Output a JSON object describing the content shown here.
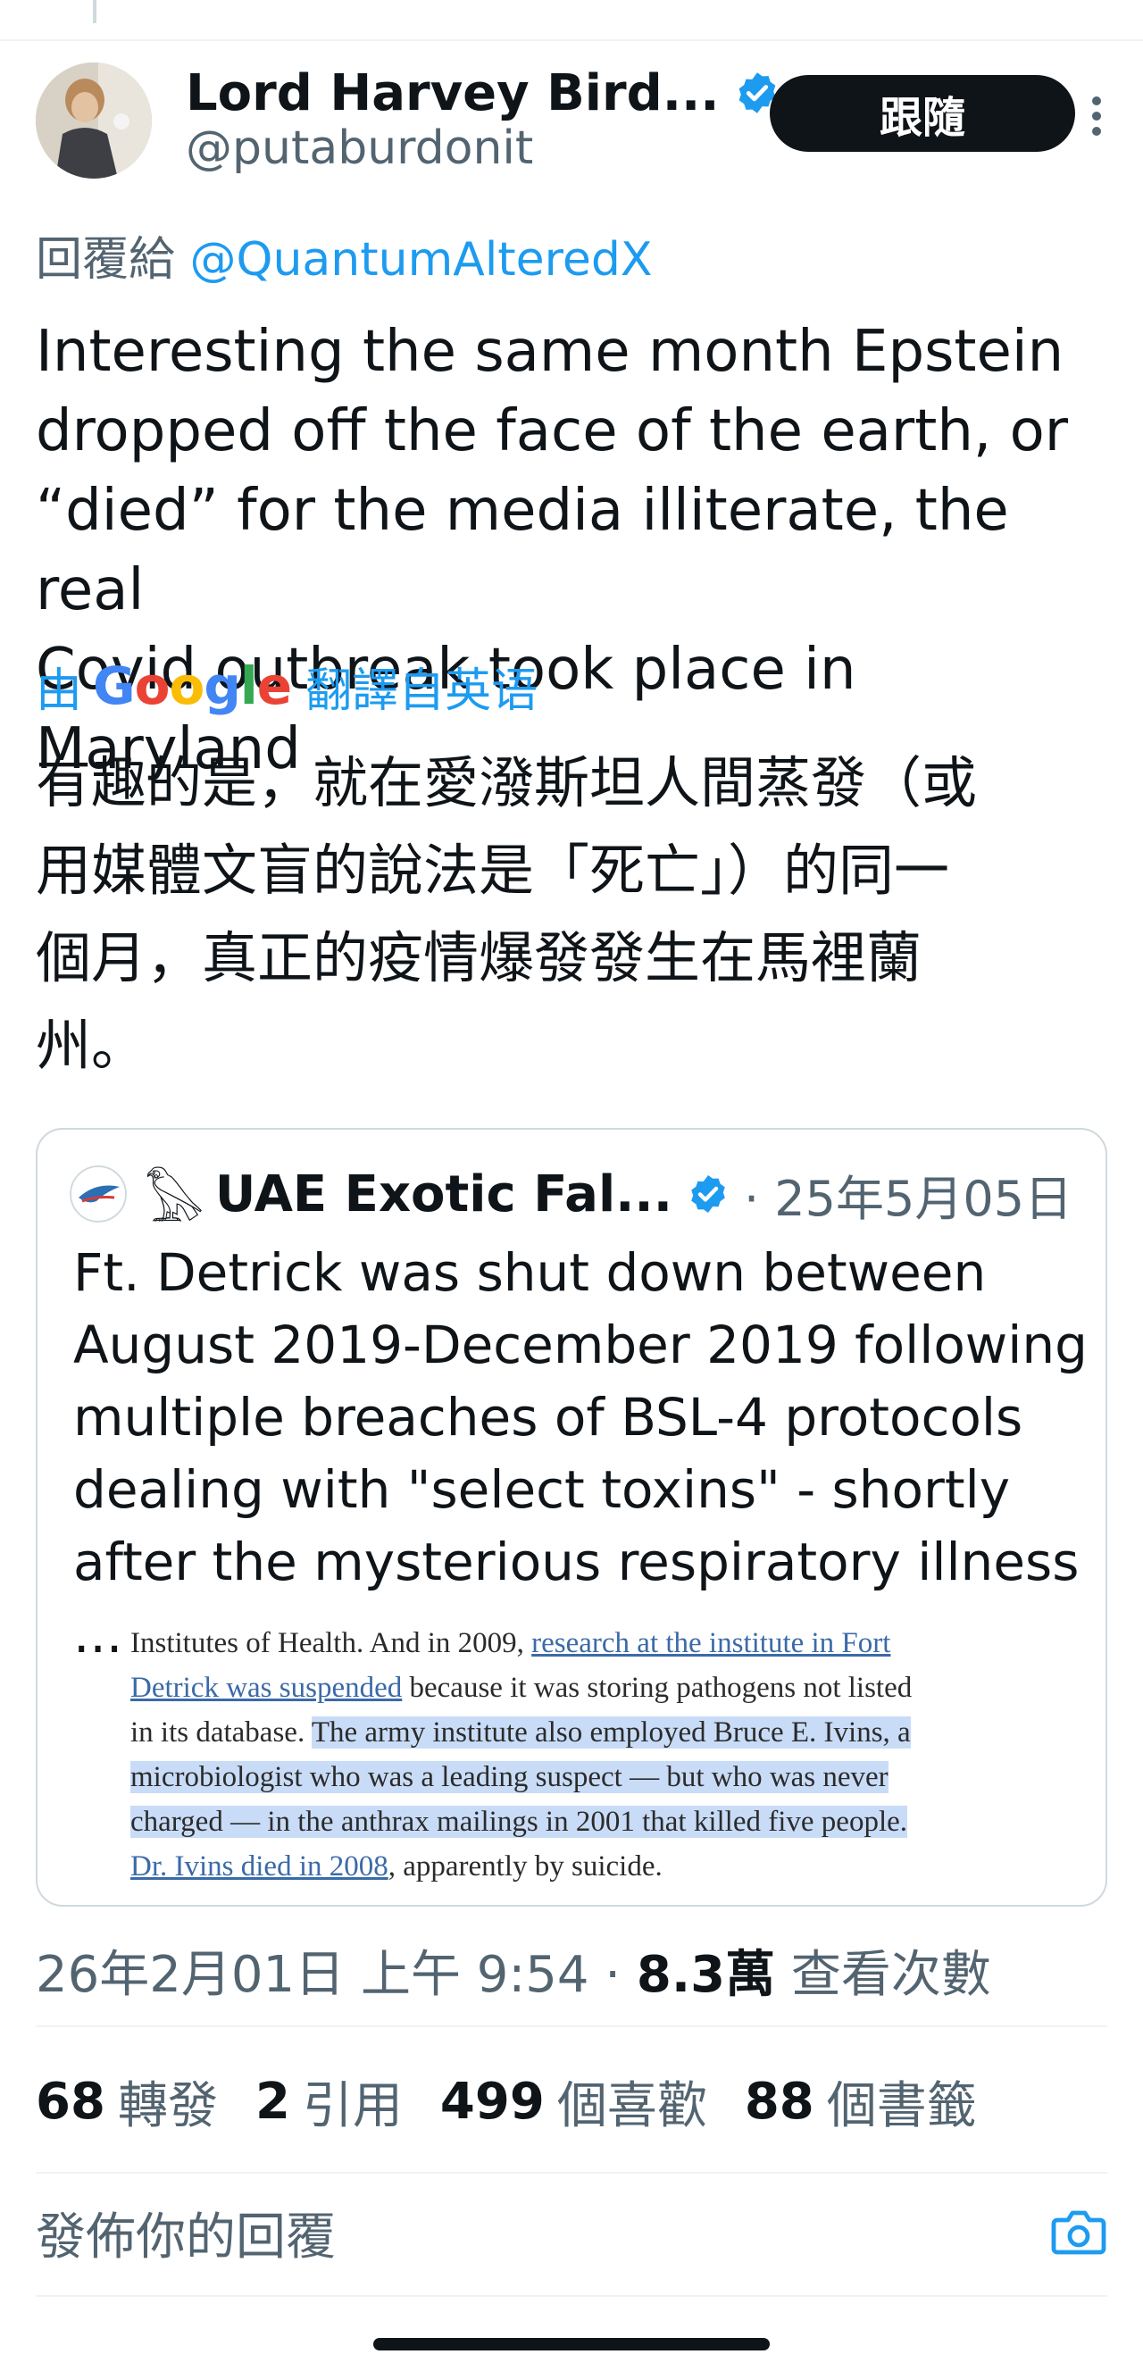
{
  "tweet": {
    "display_name": "Lord Harvey Bird...",
    "handle": "@putaburdonit",
    "follow_label": "跟隨",
    "reply_prefix": "回覆給",
    "reply_mention": "@QuantumAlteredX",
    "text_lines": [
      "Interesting the same month Epstein",
      "dropped off the face of the earth, or",
      "“died” for the media illiterate, the real",
      "Covid outbreak took place in Maryland"
    ],
    "translation": {
      "prefix": "由",
      "logo": [
        "G",
        "o",
        "o",
        "g",
        "l",
        "e"
      ],
      "suffix": "翻譯自英语",
      "lines": [
        "有趣的是，就在愛潑斯坦人間蒸發（或",
        "用媒體文盲的說法是「死亡」）的同一",
        "個月，真正的疫情爆發發生在馬裡蘭",
        "州。"
      ]
    },
    "quote": {
      "name": "UAE Exotic Fal...",
      "date": "· 25年5月05日",
      "text_lines": [
        "Ft. Detrick was shut down between",
        "August 2019-December 2019 following",
        "multiple breaches of BSL-4 protocols",
        "dealing with \"select toxins\" - shortly",
        "after the mysterious respiratory illness ..."
      ],
      "article": {
        "p1": "Institutes of Health. And in 2009, ",
        "link1a": "research at the institute in Fort",
        "link1b": "Detrick was suspended",
        "p2": " because it was storing pathogens not listed",
        "p3": "in its database. ",
        "hl1": "The army institute also employed Bruce E. Ivins, a",
        "hl2": "microbiologist who was a leading suspect — but who was never",
        "hl3": "charged — in the anthrax mailings in 2001 that killed five people.",
        "link2": "Dr. Ivins died in 2008",
        "p4": ", apparently by suicide."
      }
    },
    "timestamp": "26年2月01日 上午 9:54 · ",
    "views_count": "8.3萬",
    "views_label": " 查看次數",
    "stats": [
      {
        "count": "68",
        "label": "轉發"
      },
      {
        "count": "2",
        "label": "引用"
      },
      {
        "count": "499",
        "label": "個喜歡"
      },
      {
        "count": "88",
        "label": "個書籤"
      }
    ],
    "reply_placeholder": "發佈你的回覆"
  },
  "colors": {
    "accent": "#1d9bf0",
    "text": "#0f1419",
    "muted": "#536471",
    "highlight": "#c9dcf7"
  }
}
